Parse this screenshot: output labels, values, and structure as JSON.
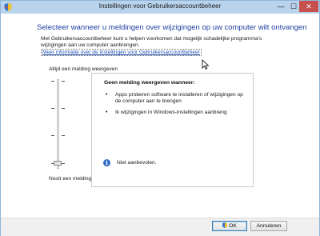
{
  "window": {
    "title": "Instellingen voor Gebruikersaccountbeheer",
    "minimize": "—",
    "maximize": "☐",
    "close": "✕"
  },
  "main": {
    "headline": "Selecteer wanneer u meldingen over wijzigingen op uw computer wilt ontvangen",
    "description": "Met Gebruikersaccountbeheer kunt u helpen voorkomen dat mogelijk schadelijke programma's wijzigingen aan uw computer aanbrengen.",
    "link": "Meer informatie over de instellingen voor Gebruikersaccountbeheer"
  },
  "slider": {
    "top_label": "Altijd een melding weergeven",
    "bottom_label": "Nooit een melding weergeven",
    "levels": 4,
    "selected_level": "Nooit een melding weergeven"
  },
  "panel": {
    "title": "Geen melding weergeven wanneer:",
    "bullets": [
      "Apps proberen software te installeren of wijzigingen op de computer aan te brengen",
      "Ik wijzigingen in Windows-instellingen aanbreng"
    ],
    "info": "Niet aanbevolen."
  },
  "footer": {
    "ok": "OK",
    "cancel": "Annuleren"
  },
  "colors": {
    "headline": "#1e3fa0",
    "link": "#1f4fb2",
    "titlebar": "#b9d3ec",
    "close_button": "#c7504c",
    "info_icon": "#2f6dc4"
  },
  "icons": [
    "uac-shield-icon",
    "cursor-icon",
    "info-icon"
  ]
}
